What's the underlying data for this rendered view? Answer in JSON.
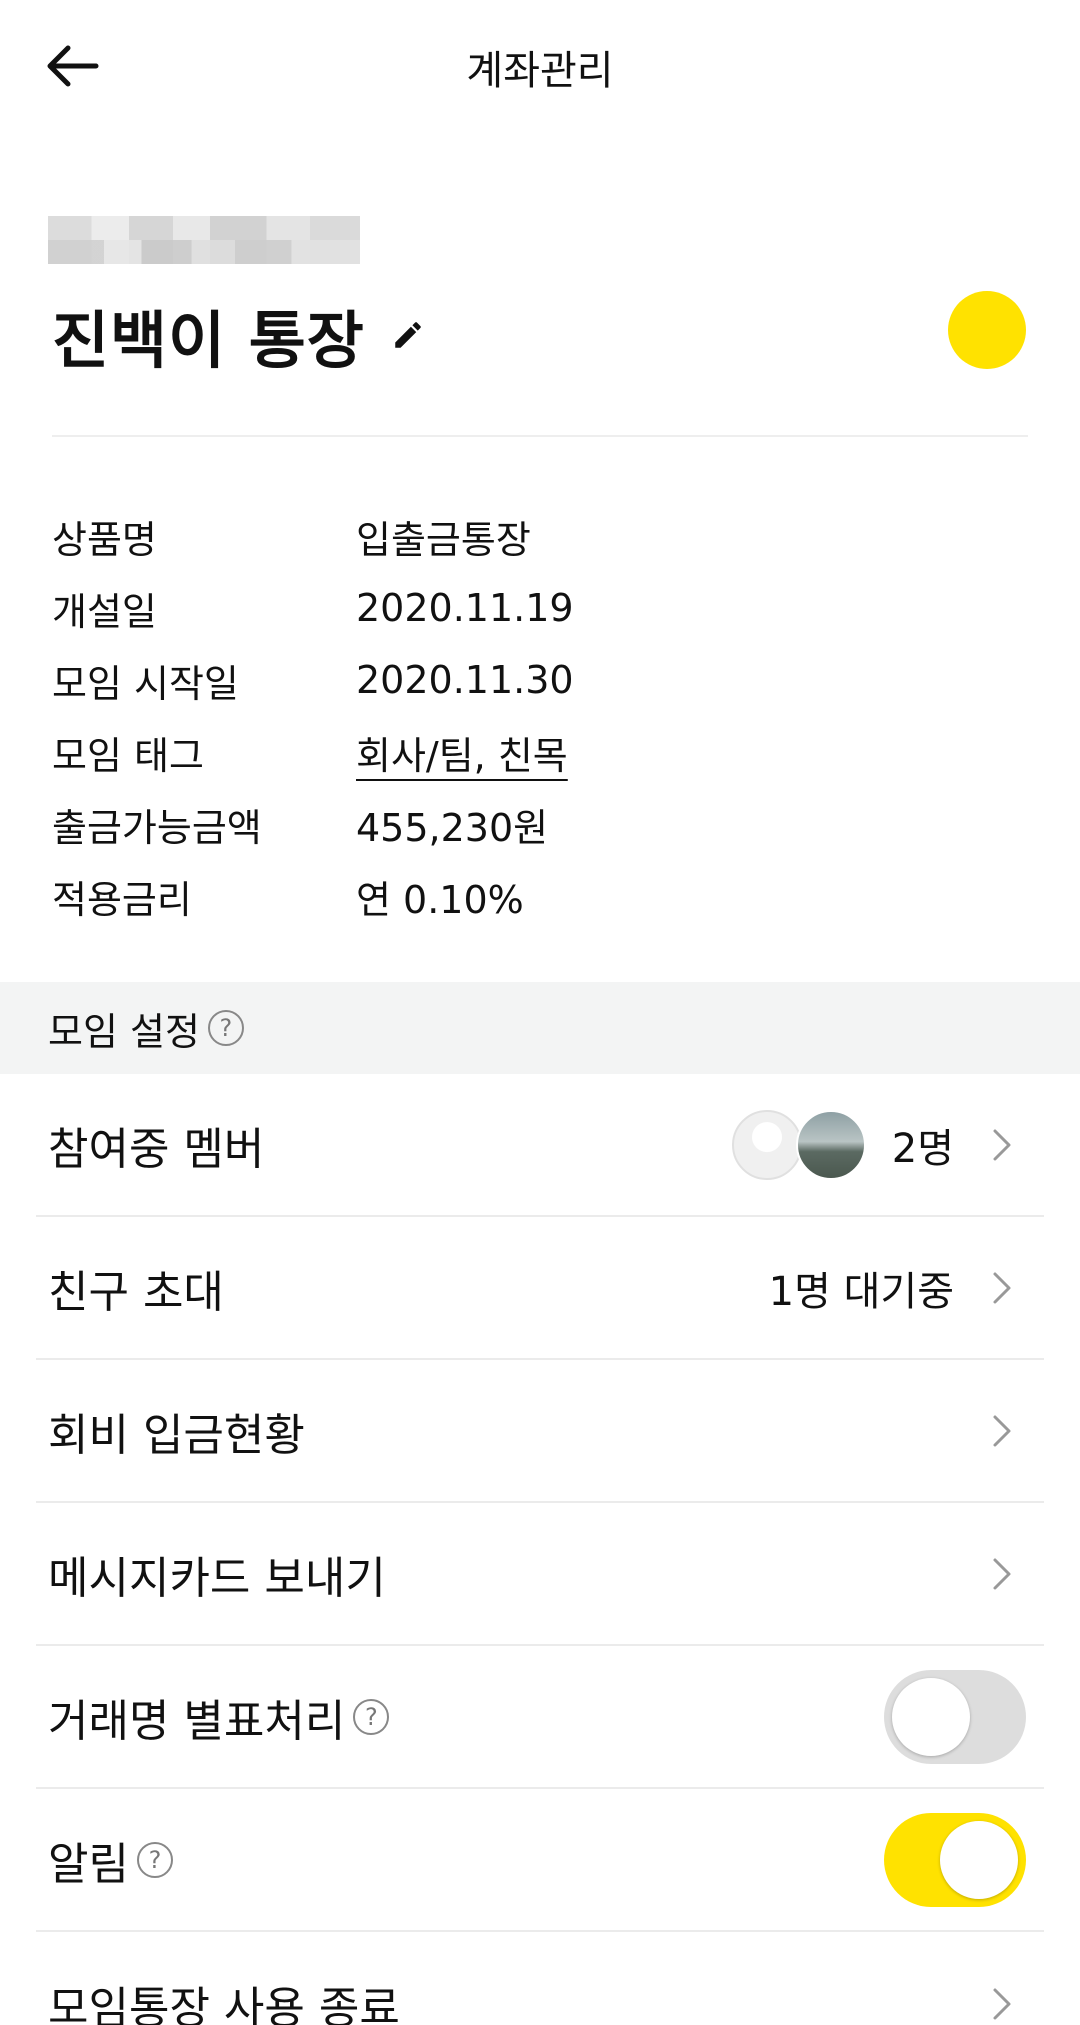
{
  "header": {
    "title": "계좌관리"
  },
  "account": {
    "name": "진백이 통장",
    "color": "#FFE200"
  },
  "info": [
    {
      "label": "상품명",
      "value": "입출금통장"
    },
    {
      "label": "개설일",
      "value": "2020.11.19"
    },
    {
      "label": "모임 시작일",
      "value": "2020.11.30"
    },
    {
      "label": "모임 태그",
      "value": "회사/팀, 친목"
    },
    {
      "label": "출금가능금액",
      "value": "455,230원"
    },
    {
      "label": "적용금리",
      "value": "연 0.10%"
    }
  ],
  "section": {
    "title": "모임 설정"
  },
  "menu": {
    "members": {
      "label": "참여중 멤버",
      "value": "2명"
    },
    "invite": {
      "label": "친구 초대",
      "value": "1명 대기중"
    },
    "dues": {
      "label": "회비 입금현황"
    },
    "message_card": {
      "label": "메시지카드 보내기"
    },
    "mask_names": {
      "label": "거래명 별표처리",
      "enabled": false
    },
    "notifications": {
      "label": "알림",
      "enabled": true
    },
    "end_usage": {
      "label": "모임통장 사용 종료"
    }
  },
  "icons": {
    "help": "?"
  }
}
